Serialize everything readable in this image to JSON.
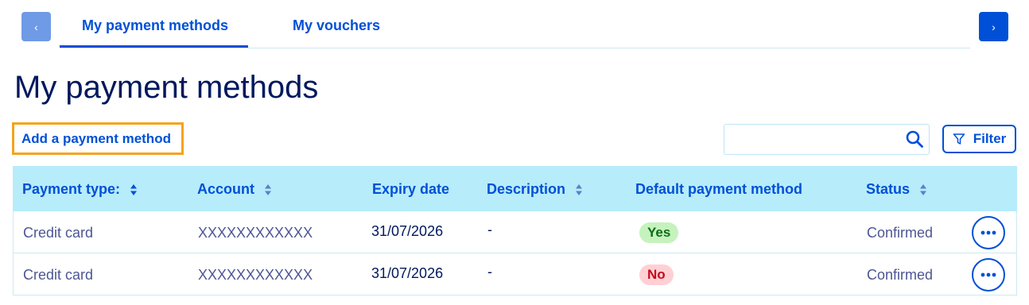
{
  "nav": {
    "prev_icon": "chevron-left-icon",
    "next_icon": "chevron-right-icon",
    "prev_glyph": "‹",
    "next_glyph": "›"
  },
  "tabs": [
    {
      "label": "My payment methods",
      "active": true
    },
    {
      "label": "My vouchers",
      "active": false
    }
  ],
  "page": {
    "title": "My payment methods",
    "add_label": "Add a payment method"
  },
  "search": {
    "value": "",
    "placeholder": "",
    "icon": "search-icon"
  },
  "filter": {
    "label": "Filter",
    "icon": "funnel-icon"
  },
  "table": {
    "columns": [
      "Payment type:",
      "Account",
      "Expiry date",
      "Description",
      "Default payment method",
      "Status"
    ],
    "rows": [
      {
        "type": "Credit card",
        "account": "XXXXXXXXXXXX",
        "expiry": "31/07/2026",
        "description": "-",
        "default": "Yes",
        "status": "Confirmed"
      },
      {
        "type": "Credit card",
        "account": "XXXXXXXXXXXX",
        "expiry": "31/07/2026",
        "description": "-",
        "default": "No",
        "status": "Confirmed"
      }
    ]
  },
  "colors": {
    "accent": "#0050d7",
    "header_bg": "#b7ecfb",
    "focus_outline": "#f5a31c",
    "yes_bg": "#c5f2bd",
    "no_bg": "#ffd0d3"
  }
}
